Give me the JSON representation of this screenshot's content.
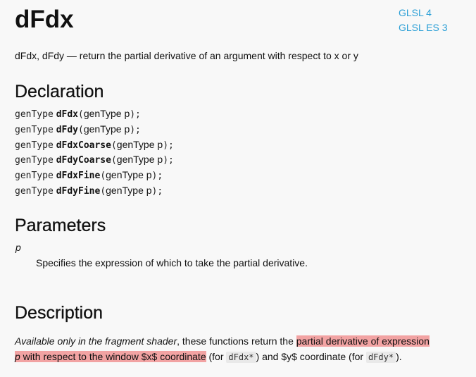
{
  "title": "dFdx",
  "versions": [
    "GLSL 4",
    "GLSL ES 3"
  ],
  "summary": "dFdx, dFdy — return the partial derivative of an argument with respect to x or y",
  "sections": {
    "declaration": "Declaration",
    "parameters": "Parameters",
    "description": "Description"
  },
  "declarations": [
    {
      "ret": "genType",
      "fn": "dFdx",
      "param_type": "genType",
      "param": "p"
    },
    {
      "ret": "genType",
      "fn": "dFdy",
      "param_type": "genType",
      "param": "p"
    },
    {
      "ret": "genType",
      "fn": "dFdxCoarse",
      "param_type": "genType",
      "param": "p"
    },
    {
      "ret": "genType",
      "fn": "dFdyCoarse",
      "param_type": "genType",
      "param": "p"
    },
    {
      "ret": "genType",
      "fn": "dFdxFine",
      "param_type": "genType",
      "param": "p"
    },
    {
      "ret": "genType",
      "fn": "dFdyFine",
      "param_type": "genType",
      "param": "p"
    }
  ],
  "parameter": {
    "name": "p",
    "description": "Specifies the expression of which to take the partial derivative."
  },
  "description": {
    "italic_lead": "Available only in the fragment shader",
    "text_1": ", these functions return the ",
    "highlight_1": "partial derivative of expression",
    "highlight_2_param": "p",
    "highlight_2_rest": " with respect to the window $x$ coordinate",
    "text_2": " (for ",
    "code_1": "dFdx*",
    "text_3": ") and $y$ coordinate (for ",
    "code_2": "dFdy*",
    "text_4": ")."
  },
  "colors": {
    "link": "#2a9fd6",
    "highlight": "#f2a3a3",
    "background": "#f8f8f8"
  }
}
